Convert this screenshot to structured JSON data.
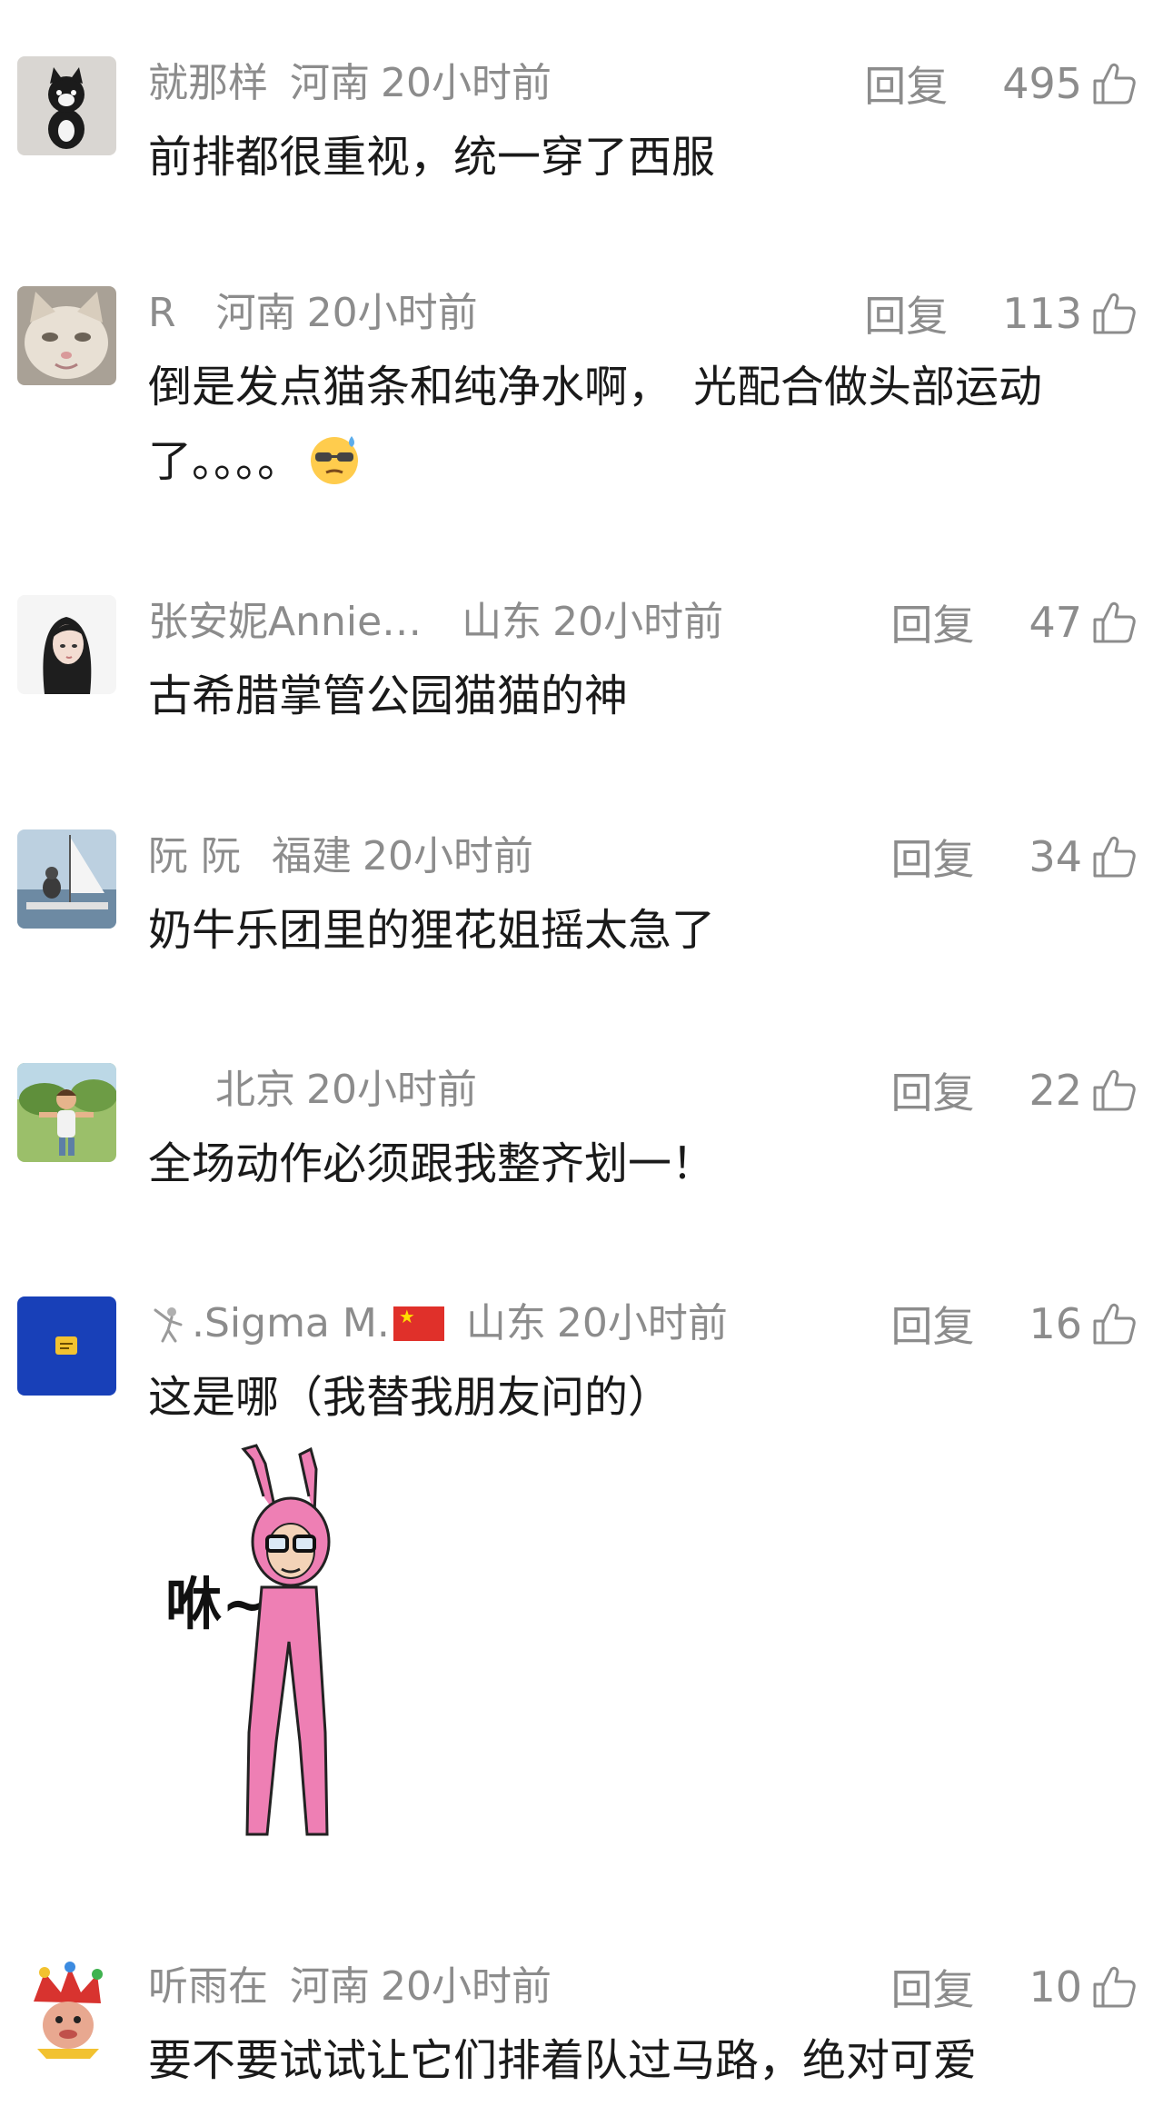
{
  "comments": [
    {
      "user": "就那样",
      "region": "河南",
      "time": "20小时前",
      "reply": "回复",
      "likes": "495",
      "text": "前排都很重视，统一穿了西服",
      "avatar_icon": "black-cat-plush-avatar"
    },
    {
      "user": "R",
      "region": "河南",
      "time": "20小时前",
      "reply": "回复",
      "likes": "113",
      "text": "倒是发点猫条和纯净水啊，　光配合做头部运动了。。。。",
      "avatar_icon": "cat-face-avatar",
      "emoji_icon": "sweat-sunglasses-emoji"
    },
    {
      "user": "张安妮Annie…",
      "region": "山东",
      "time": "20小时前",
      "reply": "回复",
      "likes": "47",
      "text": "古希腊掌管公园猫猫的神",
      "avatar_icon": "anime-girl-avatar"
    },
    {
      "user": "阮 阮",
      "region": "福建",
      "time": "20小时前",
      "reply": "回复",
      "likes": "34",
      "text": "奶牛乐团里的狸花姐摇太急了",
      "avatar_icon": "sailboat-person-avatar"
    },
    {
      "user": "",
      "region": "北京",
      "time": "20小时前",
      "reply": "回复",
      "likes": "22",
      "text": "全场动作必须跟我整齐划一！",
      "avatar_icon": "cartoon-man-avatar"
    },
    {
      "user": ".Sigma M.",
      "region": "山东",
      "time": "20小时前",
      "reply": "回复",
      "likes": "16",
      "text": "这是哪（我替我朋友问的）",
      "avatar_icon": "blue-sticker-avatar",
      "name_prefix_icon": "fencing-icon",
      "name_suffix_icon": "china-flag-icon",
      "sticker_text": "咻~",
      "sticker_icon": "pink-bunny-suit-sticker"
    },
    {
      "user": "听雨在",
      "region": "河南",
      "time": "20小时前",
      "reply": "回复",
      "likes": "10",
      "text": "要不要试试让它们排着队过马路，绝对可爱",
      "avatar_icon": "jester-avatar"
    }
  ],
  "colors": {
    "meta": "#8c8c8c",
    "text": "#1a1a1a",
    "background": "#ffffff",
    "flag": "#e0302a",
    "sticker_pink": "#ee7fb4"
  },
  "like_icon": "thumbs-up-icon"
}
